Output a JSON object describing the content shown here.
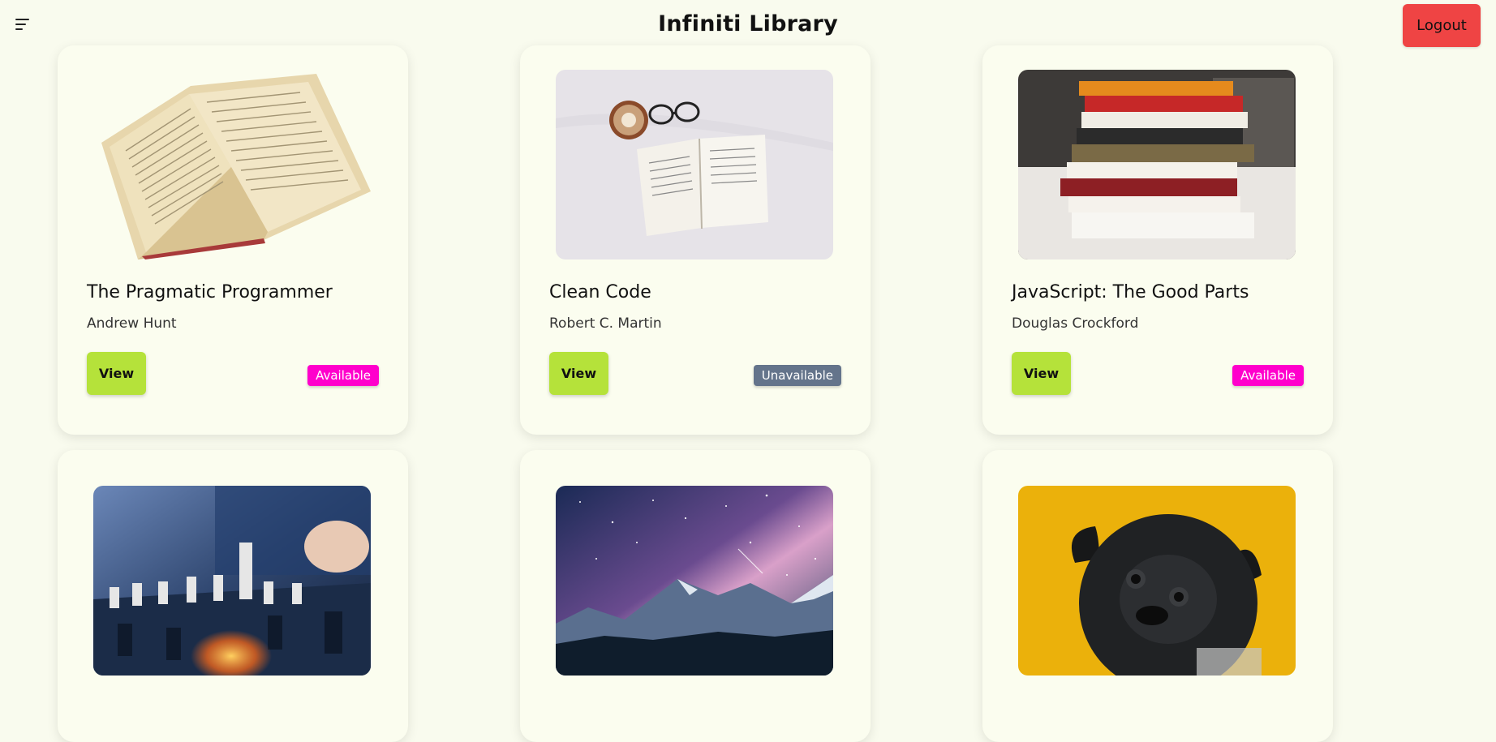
{
  "header": {
    "title": "Infiniti Library",
    "logout_label": "Logout"
  },
  "books": [
    {
      "title": "The Pragmatic Programmer",
      "author": "Andrew Hunt",
      "view_label": "View",
      "status": "Available",
      "status_color": "#ff00cc",
      "image": "open-book-photo"
    },
    {
      "title": "Clean Code",
      "author": "Robert C. Martin",
      "view_label": "View",
      "status": "Unavailable",
      "status_color": "#64748b",
      "image": "book-coffee-glasses-photo"
    },
    {
      "title": "JavaScript: The Good Parts",
      "author": "Douglas Crockford",
      "view_label": "View",
      "status": "Available",
      "status_color": "#ff00cc",
      "image": "book-stack-photo"
    },
    {
      "image": "chess-photo"
    },
    {
      "image": "night-sky-mountains-photo"
    },
    {
      "image": "pug-dog-photo"
    }
  ],
  "colors": {
    "background": "#f9fbee",
    "card": "#fbfdef",
    "view_button": "#b5e23a",
    "logout_button": "#ef4444",
    "available_badge": "#ff00cc",
    "unavailable_badge": "#64748b"
  }
}
